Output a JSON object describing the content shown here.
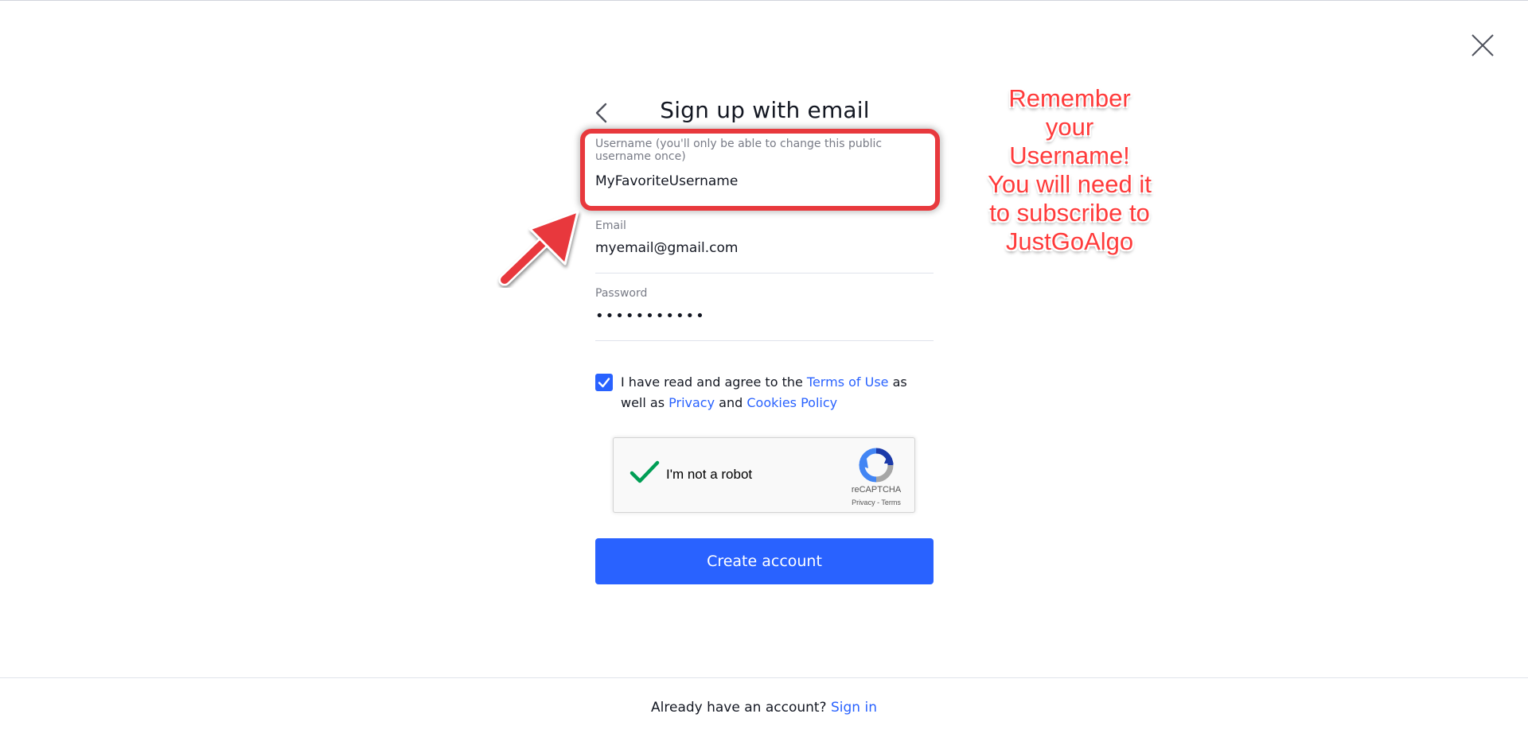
{
  "header": {
    "title": "Sign up with email"
  },
  "form": {
    "username": {
      "label": "Username (you'll only be able to change this public username once)",
      "value": "MyFavoriteUsername"
    },
    "email": {
      "label": "Email",
      "value": "myemail@gmail.com"
    },
    "password": {
      "label": "Password",
      "value": "•••••••••••"
    },
    "agree": {
      "checked": true,
      "text_before": "I have read and agree to the ",
      "terms_link": "Terms of Use",
      "text_middle": " as well as ",
      "privacy_link": "Privacy",
      "text_and": " and ",
      "cookies_link": "Cookies Policy"
    },
    "recaptcha": {
      "label": "I'm not a robot",
      "brand": "reCAPTCHA",
      "privacy": "Privacy",
      "separator": " - ",
      "terms": "Terms",
      "checked": true
    },
    "submit_label": "Create account"
  },
  "footer": {
    "prompt": "Already have an account? ",
    "signin_link": "Sign in"
  },
  "annotation": {
    "lines": [
      "Remember",
      "your",
      "Username!",
      "You will need it",
      "to subscribe to",
      "JustGoAlgo"
    ]
  },
  "colors": {
    "accent": "#2962ff",
    "annotation_red": "#e8393d",
    "text": "#131722",
    "muted": "#787b86"
  },
  "icons": {
    "close": "close-icon",
    "back": "chevron-left-icon",
    "checkbox": "checkmark-icon",
    "recaptcha": "recaptcha-logo-icon"
  }
}
